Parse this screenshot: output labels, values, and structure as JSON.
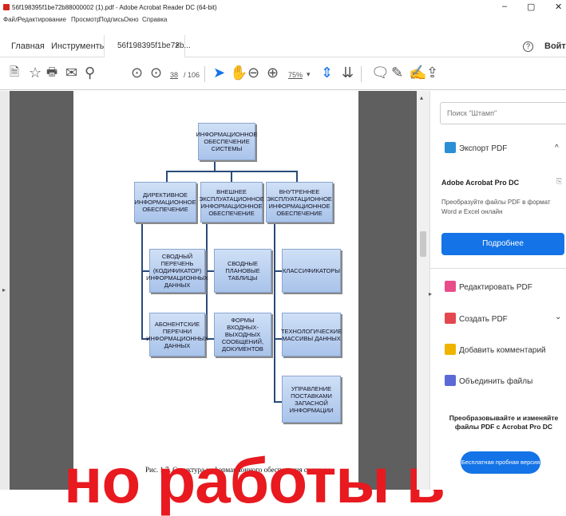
{
  "window": {
    "title": "56f198395f1be72b88000002 (1).pdf - Adobe Acrobat Reader DC (64-bit)",
    "minimize": "–",
    "maximize": "▢",
    "close": "✕"
  },
  "menu": [
    "Файл",
    "Редактирование",
    "Просмотр",
    "Подпись",
    "Окно",
    "Справка"
  ],
  "tabs": {
    "home": "Главная",
    "tools": "Инструменты",
    "document": "56f198395f1be72b...",
    "document_close": "×",
    "help": "?",
    "login": "Войти"
  },
  "toolbar": {
    "page_current": "38",
    "page_total": "/ 106",
    "zoom": "75%"
  },
  "diagram": {
    "root": "ИНФОРМАЦИОННОЕ ОБЕСПЕЧЕНИЕ СИСТЕМЫ",
    "col1_head": "ДИРЕКТИВНОЕ ИНФОРМАЦИОННОЕ ОБЕСПЕЧЕНИЕ",
    "col2_head": "ВНЕШНЕЕ ЭКСПЛУАТАЦИОННОЕ ИНФОРМАЦИОННОЕ ОБЕСПЕЧЕНИЕ",
    "col3_head": "ВНУТРЕННЕЕ ЭКСПЛУАТАЦИОННОЕ ИНФОРМАЦИОННОЕ ОБЕСПЕЧЕНИЕ",
    "c1a": "СВОДНЫЙ ПЕРЕЧЕНЬ (КОДИФИКАТОР) ИНФОРМАЦИОННЫХ ДАННЫХ",
    "c1b": "АБОНЕНТСКИЕ ПЕРЕЧНИ ИНФОРМАЦИОННЫХ ДАННЫХ",
    "c2a": "СВОДНЫЕ ПЛАНОВЫЕ ТАБЛИЦЫ",
    "c2b": "ФОРМЫ ВХОДНЫХ-ВЫХОДНЫХ СООБЩЕНИЙ, ДОКУМЕНТОВ",
    "c3a": "КЛАССИФИКАТОРЫ",
    "c3b": "ТЕХНОЛОГИЧЕСКИЕ МАССИВЫ ДАННЫХ",
    "c3c": "УПРАВЛЕНИЕ ПОСТАВКАМИ ЗАПАСНОЙ ИНФОРМАЦИИ",
    "caption": "Рис. 1.7. Структура информационного обеспечения системы"
  },
  "watermark": "но работы в",
  "rightpanel": {
    "search_placeholder": "Поиск \"Штамп\"",
    "export_pdf": "Экспорт PDF",
    "export_chevron": "^",
    "product": "Adobe Acrobat Pro DC",
    "product_desc": "Преобразуйте файлы PDF в формат Word и Excel онлайн",
    "more_button": "Подробнее",
    "edit_pdf": "Редактировать PDF",
    "create_pdf": "Создать PDF",
    "create_chevron": "⌄",
    "add_comment": "Добавить комментарий",
    "combine": "Объединить файлы",
    "promo": "Преобразовывайте и изменяйте файлы PDF с Acrobat Pro DC",
    "trial_button": "Бесплатная пробная версия"
  },
  "colors": {
    "accent": "#1473e6",
    "doc_bg": "#5f5f5f",
    "box_fill": "#b8cdef",
    "watermark": "#e8191f"
  }
}
